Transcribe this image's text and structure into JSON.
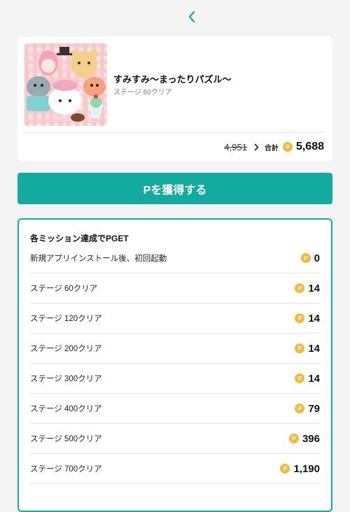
{
  "header": {
    "back_icon": "chevron-left-icon",
    "accent_color": "#13aaa0"
  },
  "app": {
    "title": "すみすみ〜まったりパズル〜",
    "subtitle": "ステージ 60クリア",
    "old_points": "4,951",
    "total_label": "合計",
    "total_points": "5,688",
    "coin_symbol": "P"
  },
  "cta": {
    "label": "Pを獲得する",
    "color": "#13aaa0"
  },
  "missions": {
    "title": "各ミッション達成でPGET",
    "items": [
      {
        "label": "新規アプリインストール後、初回起動",
        "points": "0"
      },
      {
        "label": "ステージ 60クリア",
        "points": "14"
      },
      {
        "label": "ステージ 120クリア",
        "points": "14"
      },
      {
        "label": "ステージ 200クリア",
        "points": "14"
      },
      {
        "label": "ステージ 300クリア",
        "points": "14"
      },
      {
        "label": "ステージ 400クリア",
        "points": "79"
      },
      {
        "label": "ステージ 500クリア",
        "points": "396"
      },
      {
        "label": "ステージ 700クリア",
        "points": "1,190"
      }
    ]
  }
}
